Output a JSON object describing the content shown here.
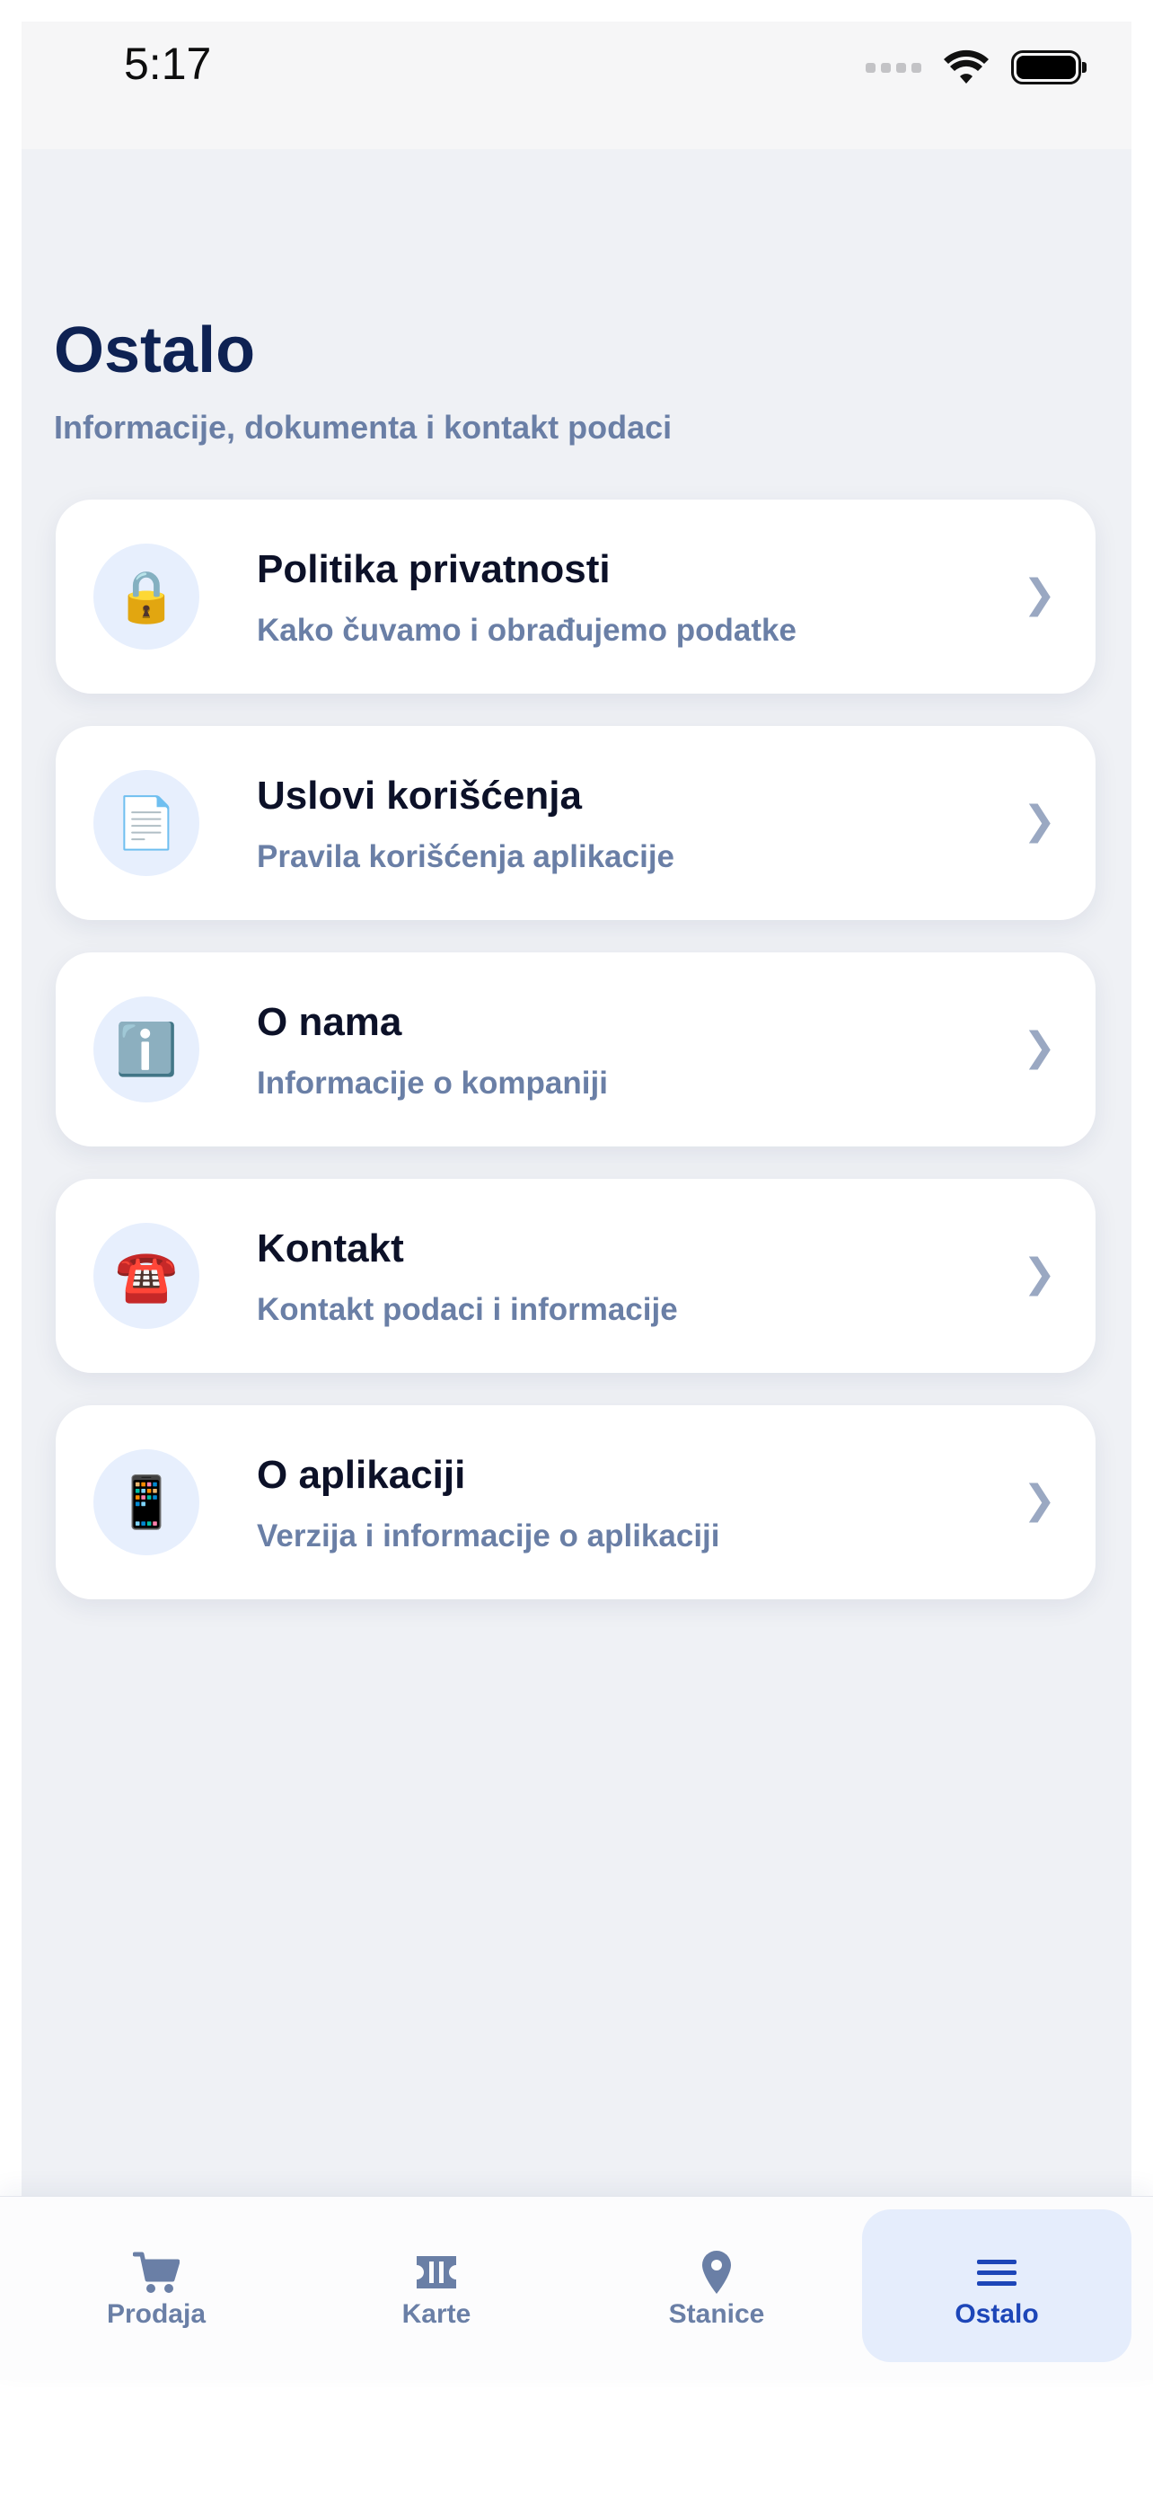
{
  "status_bar": {
    "time": "5:17"
  },
  "header": {
    "title": "Ostalo",
    "subtitle": "Informacije, dokumenta i kontakt podaci"
  },
  "menu": {
    "items": [
      {
        "icon": "lock-icon",
        "glyph": "🔒",
        "title": "Politika privatnosti",
        "subtitle": "Kako čuvamo i obrađujemo podatke"
      },
      {
        "icon": "document-icon",
        "glyph": "📄",
        "title": "Uslovi korišćenja",
        "subtitle": "Pravila korišćenja aplikacije"
      },
      {
        "icon": "info-icon",
        "glyph": "ℹ️",
        "title": "O nama",
        "subtitle": "Informacije o kompaniji"
      },
      {
        "icon": "telephone-icon",
        "glyph": "☎️",
        "title": "Kontakt",
        "subtitle": "Kontakt podaci i informacije"
      },
      {
        "icon": "mobile-phone-icon",
        "glyph": "📱",
        "title": "O aplikaciji",
        "subtitle": "Verzija i informacije o aplikaciji"
      }
    ],
    "chevron": "❯"
  },
  "tab_bar": {
    "tabs": [
      {
        "label": "Prodaja",
        "icon": "cart-icon",
        "active": false
      },
      {
        "label": "Karte",
        "icon": "ticket-icon",
        "active": false
      },
      {
        "label": "Stanice",
        "icon": "location-pin-icon",
        "active": false
      },
      {
        "label": "Ostalo",
        "icon": "menu-icon",
        "active": true
      }
    ]
  },
  "colors": {
    "accent": "#1d46b8",
    "muted": "#6a7fa6",
    "title": "#0e2253",
    "icon_bg": "#e7effd"
  }
}
